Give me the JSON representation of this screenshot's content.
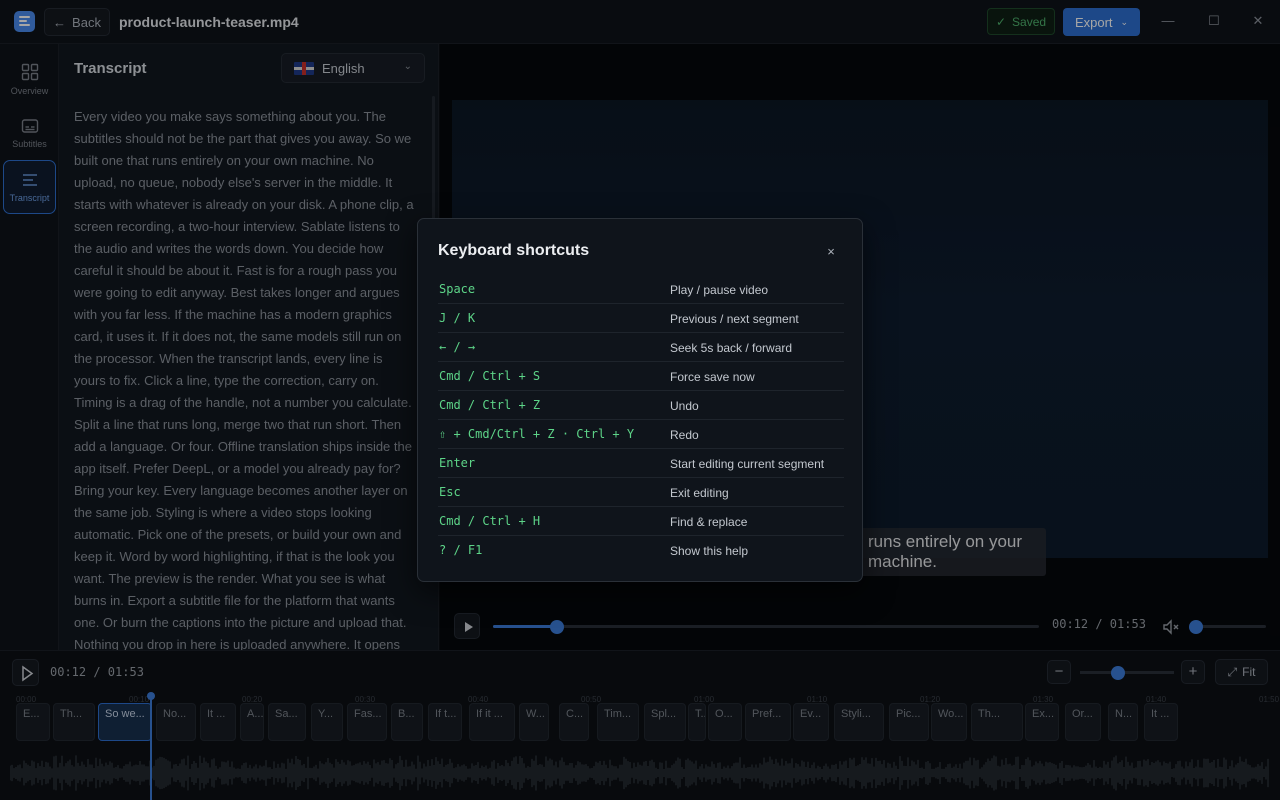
{
  "app": {
    "back_label": "Back",
    "file_name": "product-launch-teaser.mp4",
    "saved_label": "Saved",
    "export_label": "Export"
  },
  "rail": [
    {
      "label": "Overview",
      "icon": "grid-icon"
    },
    {
      "label": "Subtitles",
      "icon": "subtitles-icon"
    },
    {
      "label": "Transcript",
      "icon": "lines-icon",
      "active": true
    }
  ],
  "transcript": {
    "title": "Transcript",
    "language": "English",
    "text": "Every video you make says something about you. The subtitles should not be the part that gives you away. So we built one that runs entirely on your own machine. No upload, no queue, nobody else's server in the middle. It starts with whatever is already on your disk. A phone clip, a screen recording, a two-hour interview. Sablate listens to the audio and writes the words down. You decide how careful it should be about it. Fast is for a rough pass you were going to edit anyway. Best takes longer and argues with you far less. If the machine has a modern graphics card, it uses it. If it does not, the same models still run on the processor. When the transcript lands, every line is yours to fix. Click a line, type the correction, carry on. Timing is a drag of the handle, not a number you calculate. Split a line that runs long, merge two that run short. Then add a language. Or four. Offline translation ships inside the app itself. Prefer DeepL, or a model you already pay for? Bring your key. Every language becomes another layer on the same job. Styling is where a video stops looking automatic. Pick one of the presets, or build your own and keep it. Word by word highlighting, if that is the look you want. The preview is the render. What you see is what burns in. Export a subtitle file for the platform that wants one. Or burn the captions into the picture and upload that. Nothing you drop in here is uploaded anywhere. It opens"
  },
  "preview": {
    "caption_line1": "runs entirely on your",
    "caption_line2": "machine.",
    "time": "00:12 / 01:53",
    "progress": 0.118,
    "volume": 0.0
  },
  "timeline": {
    "time": "00:12 / 01:53",
    "zoom_minus": "−",
    "zoom_plus": "+",
    "fit_label": "Fit",
    "zoom": 0.4,
    "ticks": [
      "00:00",
      "00:10",
      "00:20",
      "00:30",
      "00:40",
      "00:50",
      "01:00",
      "01:10",
      "01:20",
      "01:30",
      "01:40",
      "01:50"
    ],
    "segments": [
      "E...",
      "Th...",
      "So we...",
      "No...",
      "It ...",
      "A...",
      "Sa...",
      "Y...",
      "Fas...",
      "B...",
      "If t...",
      "If it ...",
      "W...",
      "C...",
      "Tim...",
      "Spl...",
      "T...",
      "O...",
      "Pref...",
      "Ev...",
      "Styli...",
      "Pic...",
      "Wo...",
      "Th...",
      "Ex...",
      "Or...",
      "N...",
      "It ..."
    ],
    "active_segment": 2
  },
  "shortcuts": {
    "title": "Keyboard shortcuts",
    "close": "×",
    "rows": [
      {
        "key": "Space",
        "desc": "Play / pause video"
      },
      {
        "key": "J / K",
        "desc": "Previous / next segment"
      },
      {
        "key": "← / →",
        "desc": "Seek 5s back / forward"
      },
      {
        "key": "Cmd / Ctrl + S",
        "desc": "Force save now"
      },
      {
        "key": "Cmd / Ctrl + Z",
        "desc": "Undo"
      },
      {
        "key": "⇧ + Cmd/Ctrl + Z · Ctrl + Y",
        "desc": "Redo"
      },
      {
        "key": "Enter",
        "desc": "Start editing current segment"
      },
      {
        "key": "Esc",
        "desc": "Exit editing"
      },
      {
        "key": "Cmd / Ctrl + H",
        "desc": "Find & replace"
      },
      {
        "key": "? / F1",
        "desc": "Show this help"
      }
    ]
  },
  "colors": {
    "accent": "#2d6fd1",
    "shortcut_key": "#5dd488",
    "saved": "#4fb36e"
  }
}
